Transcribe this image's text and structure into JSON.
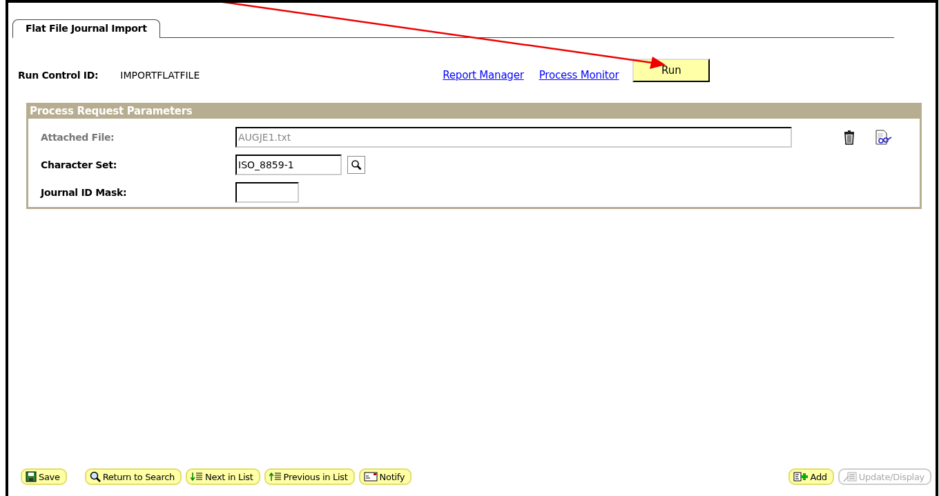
{
  "tab": {
    "label": "Flat File Journal Import",
    "selected": true
  },
  "run_control": {
    "label": "Run Control ID:",
    "value": "IMPORTFLATFILE"
  },
  "links": [
    "Report Manager",
    "Process Monitor"
  ],
  "run_button": "Run",
  "panel": {
    "title": "Process Request Parameters",
    "fields": [
      {
        "kind": "file",
        "label": "Attached File:",
        "value": "AUGJE1.txt",
        "disabled": true
      },
      {
        "kind": "lookup",
        "label": "Character Set:",
        "value": "ISO_8859-1",
        "disabled": false
      },
      {
        "kind": "short",
        "label": "Journal ID Mask:",
        "disabled": false
      }
    ]
  },
  "toolbar_left": [
    {
      "kind": "save",
      "label": "Save",
      "disabled": false
    },
    {
      "kind": "search",
      "label": "Return to Search",
      "disabled": false
    },
    {
      "kind": "next",
      "label": "Next in List",
      "disabled": false
    },
    {
      "kind": "previous",
      "label": "Previous in List",
      "disabled": false
    },
    {
      "kind": "notify",
      "label": "Notify",
      "disabled": false
    }
  ],
  "toolbar_right": [
    {
      "kind": "add",
      "label": "Add",
      "disabled": false
    },
    {
      "kind": "update",
      "label": "Update/Display",
      "disabled": true
    }
  ]
}
